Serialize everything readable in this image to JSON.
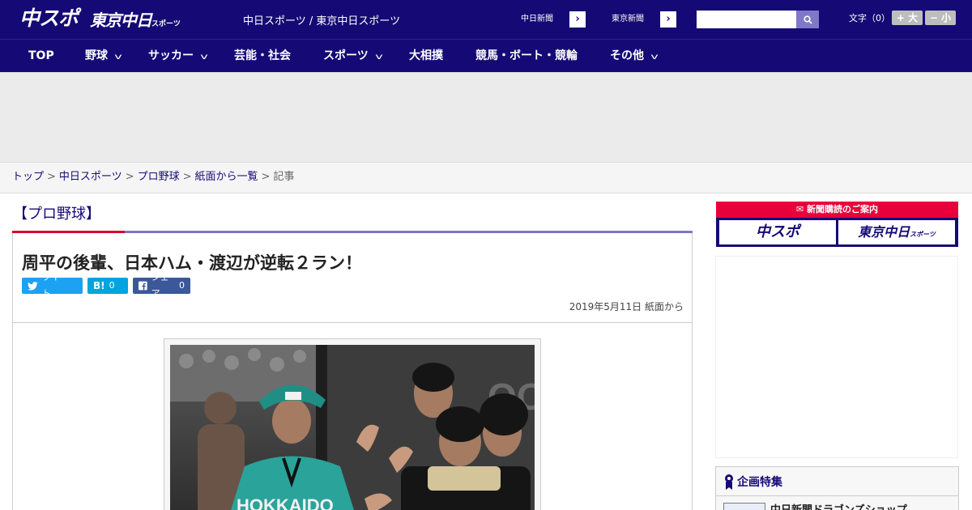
{
  "header": {
    "logo_chuspo": "中スポ",
    "logo_tokyo": "東京中日",
    "logo_tokyo_suffix": "スポーツ",
    "site_title": "中日スポーツ / 東京中日スポーツ",
    "newspaper_links": [
      {
        "label": "中日新聞"
      },
      {
        "label": "東京新聞"
      }
    ],
    "search": {
      "placeholder": "",
      "icon": "search-icon"
    },
    "font_size": {
      "label": "文字（0）",
      "larger": "+ 大",
      "smaller": "− 小"
    }
  },
  "nav": {
    "items": [
      {
        "label": "TOP",
        "dropdown": false
      },
      {
        "label": "野球",
        "dropdown": true
      },
      {
        "label": "サッカー",
        "dropdown": true
      },
      {
        "label": "芸能・社会",
        "dropdown": false
      },
      {
        "label": "スポーツ",
        "dropdown": true
      },
      {
        "label": "大相撲",
        "dropdown": false
      },
      {
        "label": "競馬・ボート・競輪",
        "dropdown": false
      },
      {
        "label": "その他",
        "dropdown": true
      }
    ]
  },
  "breadcrumb": {
    "items": [
      "トップ",
      "中日スポーツ",
      "プロ野球",
      "紙面から一覧"
    ],
    "separator": ">",
    "current": "記事"
  },
  "article": {
    "category": "【プロ野球】",
    "headline": "周平の後輩、日本ハム・渡辺が逆転２ラン！",
    "share": {
      "tweet": "ツイート",
      "hatena_mark": "B!",
      "hatena_count": "0",
      "facebook": "シェア",
      "facebook_count": "0"
    },
    "date": "2019年5月11日 紙面から",
    "photo_jersey_text": "HOKKAIDO"
  },
  "sidebar": {
    "subscribe": {
      "heading": "新聞購読のご案内",
      "chuspo": "中スポ",
      "tokyo": "東京中日",
      "tokyo_suffix": "スポーツ"
    },
    "kikaku": {
      "heading": "企画特集",
      "first_item": "中日新聞ドラゴンズショップ"
    }
  },
  "colors": {
    "brand_navy": "#150a75",
    "accent_red": "#d6002a",
    "twitter": "#1da1f2",
    "hatena": "#00a4de",
    "facebook": "#3b5998"
  }
}
